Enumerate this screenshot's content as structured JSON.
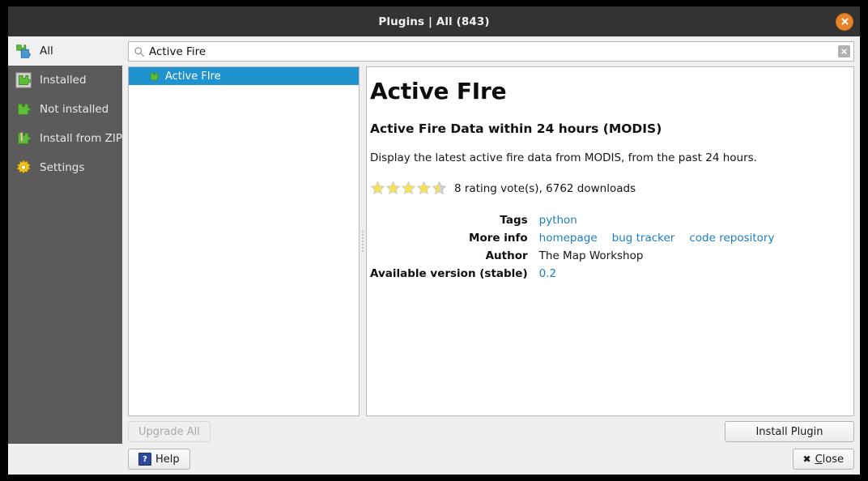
{
  "window": {
    "title": "Plugins | All (843)",
    "close_icon": "close-icon"
  },
  "sidebar": {
    "items": [
      {
        "label": "All",
        "icon": "puzzle-all-icon",
        "selected": true
      },
      {
        "label": "Installed",
        "icon": "puzzle-installed-icon",
        "selected": false
      },
      {
        "label": "Not installed",
        "icon": "puzzle-not-installed-icon",
        "selected": false
      },
      {
        "label": "Install from ZIP",
        "icon": "puzzle-zip-icon",
        "selected": false
      },
      {
        "label": "Settings",
        "icon": "gear-icon",
        "selected": false
      }
    ]
  },
  "search": {
    "value": "Active Fire",
    "placeholder": "Search...",
    "icon": "search-icon",
    "clear_icon": "clear-icon"
  },
  "plugin_list": {
    "items": [
      {
        "label": "Active FIre",
        "icon": "puzzle-plugin-icon",
        "selected": true
      }
    ]
  },
  "detail": {
    "title": "Active FIre",
    "subtitle": "Active Fire Data within 24 hours (MODIS)",
    "description": "Display the latest active fire data from MODIS, from the past 24 hours.",
    "rating": {
      "stars_filled": 4.5,
      "stars_total": 5,
      "text": "8 rating vote(s), 6762 downloads",
      "votes": 8,
      "downloads": 6762
    },
    "meta": [
      {
        "label": "Tags",
        "type": "links",
        "values": [
          "python"
        ]
      },
      {
        "label": "More info",
        "type": "links",
        "values": [
          "homepage",
          "bug tracker",
          "code repository"
        ]
      },
      {
        "label": "Author",
        "type": "text",
        "values": [
          "The Map Workshop"
        ]
      },
      {
        "label": "Available version (stable)",
        "type": "links",
        "values": [
          "0.2"
        ]
      }
    ]
  },
  "buttons": {
    "upgrade_all": "Upgrade All",
    "upgrade_all_disabled": true,
    "install_plugin": "Install Plugin",
    "help": "Help",
    "help_icon": "question-mark-icon",
    "close": "Close",
    "close_icon": "x-icon"
  },
  "colors": {
    "titlebar_bg": "#333333",
    "sidebar_bg": "#5b5b5b",
    "selection_blue": "#1f93d0",
    "link_blue": "#1a7fc1",
    "close_orange": "#e8832a",
    "star_yellow": "#f5e05a",
    "star_empty": "#cfcfcf"
  }
}
